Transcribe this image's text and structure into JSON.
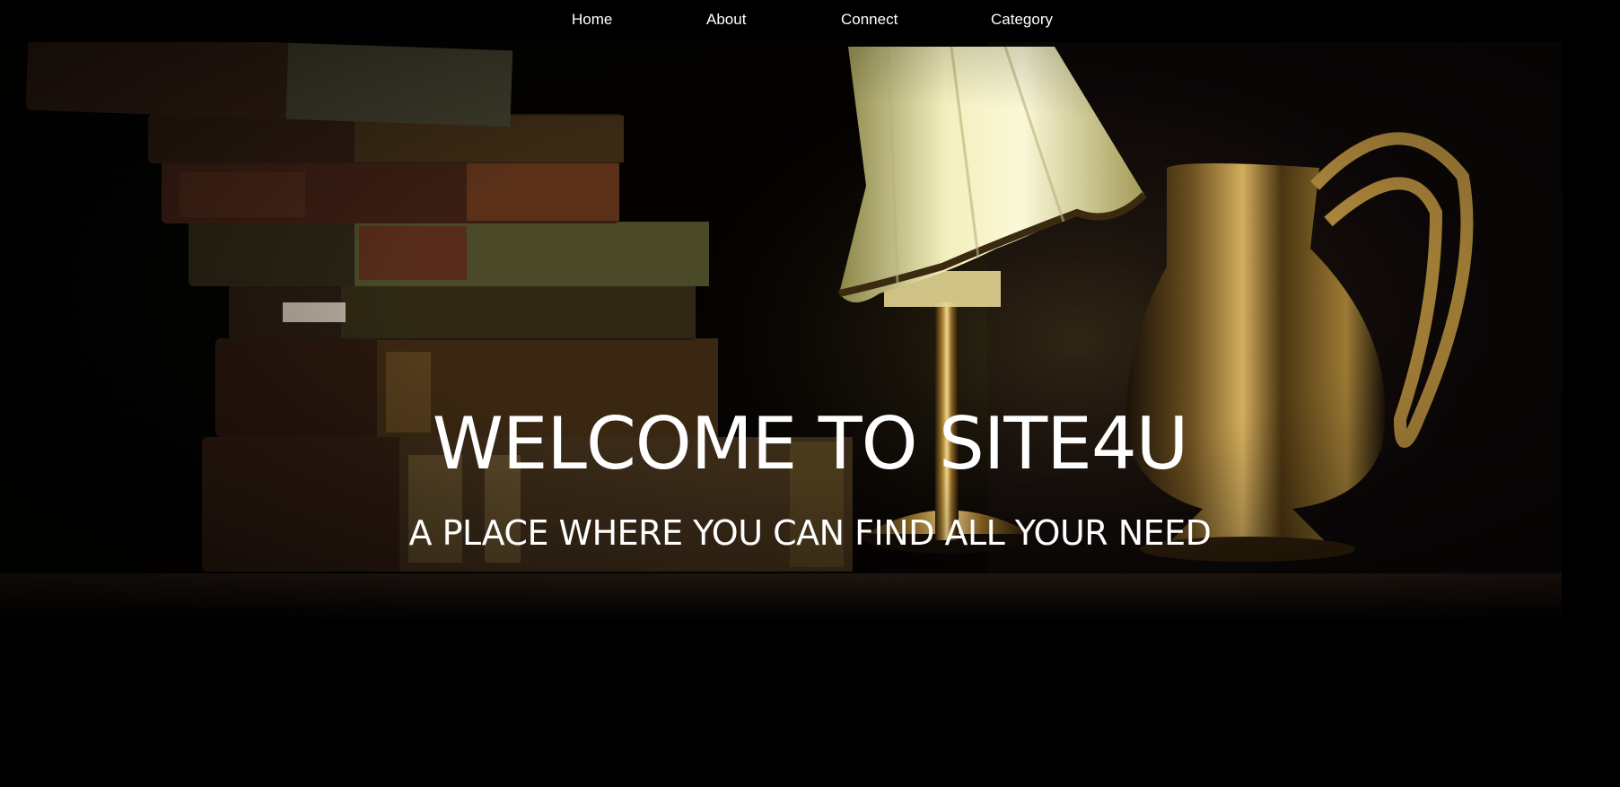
{
  "nav": {
    "items": [
      {
        "label": "Home"
      },
      {
        "label": "About"
      },
      {
        "label": "Connect"
      },
      {
        "label": "Category"
      }
    ]
  },
  "hero": {
    "title": "WELCOME TO SITE4U",
    "subtitle": "A PLACE WHERE YOU CAN FIND ALL YOUR NEED",
    "background": "books-lamp-jug-photo"
  },
  "colors": {
    "background": "#000000",
    "text": "#ffffff",
    "lamp_glow": "#e8e4a8",
    "brass": "#b08a3a"
  }
}
